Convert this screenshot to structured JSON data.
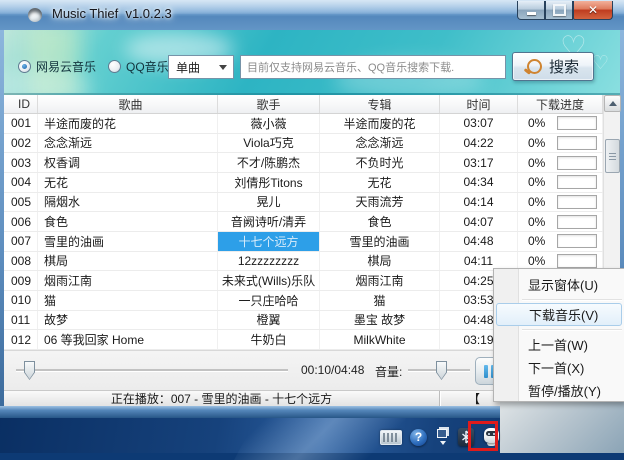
{
  "window": {
    "title": "Music Thief  v1.0.2.3"
  },
  "toolbar": {
    "source_radios": [
      {
        "label": "网易云音乐",
        "selected": true
      },
      {
        "label": "QQ音乐",
        "selected": false
      }
    ],
    "type_dropdown_value": "单曲",
    "search_input_hint": "目前仅支持网易云音乐、QQ音乐搜索下载.",
    "search_button_label": "搜索"
  },
  "table": {
    "columns": [
      "ID",
      "歌曲",
      "歌手",
      "专辑",
      "时间",
      "下载进度"
    ],
    "rows": [
      {
        "id": "001",
        "song": "半途而废的花",
        "artist": "薇小薇",
        "album": "半途而废的花",
        "time": "03:07",
        "progress": "0%"
      },
      {
        "id": "002",
        "song": "念念渐远",
        "artist": "Viola巧克",
        "album": "念念渐远",
        "time": "04:22",
        "progress": "0%"
      },
      {
        "id": "003",
        "song": "权香调",
        "artist": "不才/陈鹏杰",
        "album": "不负时光",
        "time": "03:17",
        "progress": "0%"
      },
      {
        "id": "004",
        "song": "无花",
        "artist": "刘倩彤Titons",
        "album": "无花",
        "time": "04:34",
        "progress": "0%"
      },
      {
        "id": "005",
        "song": "隔烟水",
        "artist": "晃儿",
        "album": "天雨流芳",
        "time": "04:14",
        "progress": "0%"
      },
      {
        "id": "006",
        "song": "食色",
        "artist": "音阙诗听/清弄",
        "album": "食色",
        "time": "04:07",
        "progress": "0%"
      },
      {
        "id": "007",
        "song": "雪里的油画",
        "artist": "十七个远方",
        "album": "雪里的油画",
        "time": "04:48",
        "progress": "0%",
        "artist_selected": true
      },
      {
        "id": "008",
        "song": "棋局",
        "artist": "12zzzzzzzz",
        "album": "棋局",
        "time": "04:11",
        "progress": "0%"
      },
      {
        "id": "009",
        "song": "烟雨江南",
        "artist": "未来式(Wills)乐队",
        "album": "烟雨江南",
        "time": "04:25"
      },
      {
        "id": "010",
        "song": "猫",
        "artist": "一只庄哈哈",
        "album": "猫",
        "time": "03:53"
      },
      {
        "id": "011",
        "song": "故梦",
        "artist": "橙翼",
        "album": "墨宝 故梦",
        "time": "04:48"
      },
      {
        "id": "012",
        "song": "06 等我回家 Home",
        "artist": "牛奶白",
        "album": "MilkWhite",
        "time": "03:19"
      }
    ]
  },
  "player": {
    "time_display": "00:10/04:48",
    "volume_label": "音量:"
  },
  "status_bar": {
    "now_playing": "正在播放：007 - 雪里的油画 - 十七个远方",
    "right_text": "【"
  },
  "context_menu": {
    "items": [
      {
        "label": "显示窗体(U)",
        "separator_after": true
      },
      {
        "label": "下载音乐(V)",
        "highlighted": true,
        "separator_after": true
      },
      {
        "label": "上一首(W)"
      },
      {
        "label": "下一首(X)"
      },
      {
        "label": "暂停/播放(Y)"
      }
    ]
  },
  "tray": {
    "icons": [
      "keyboard-icon",
      "help-icon",
      "restore-window-icon",
      "bluetooth-icon",
      "music-thief-tray-icon"
    ],
    "annotation_color": "#df1b1b"
  },
  "colors": {
    "selected_cell_bg": "#2d9fe8",
    "banner_teal": "#2db4c3",
    "titlebar_blue": "#5488bc"
  }
}
